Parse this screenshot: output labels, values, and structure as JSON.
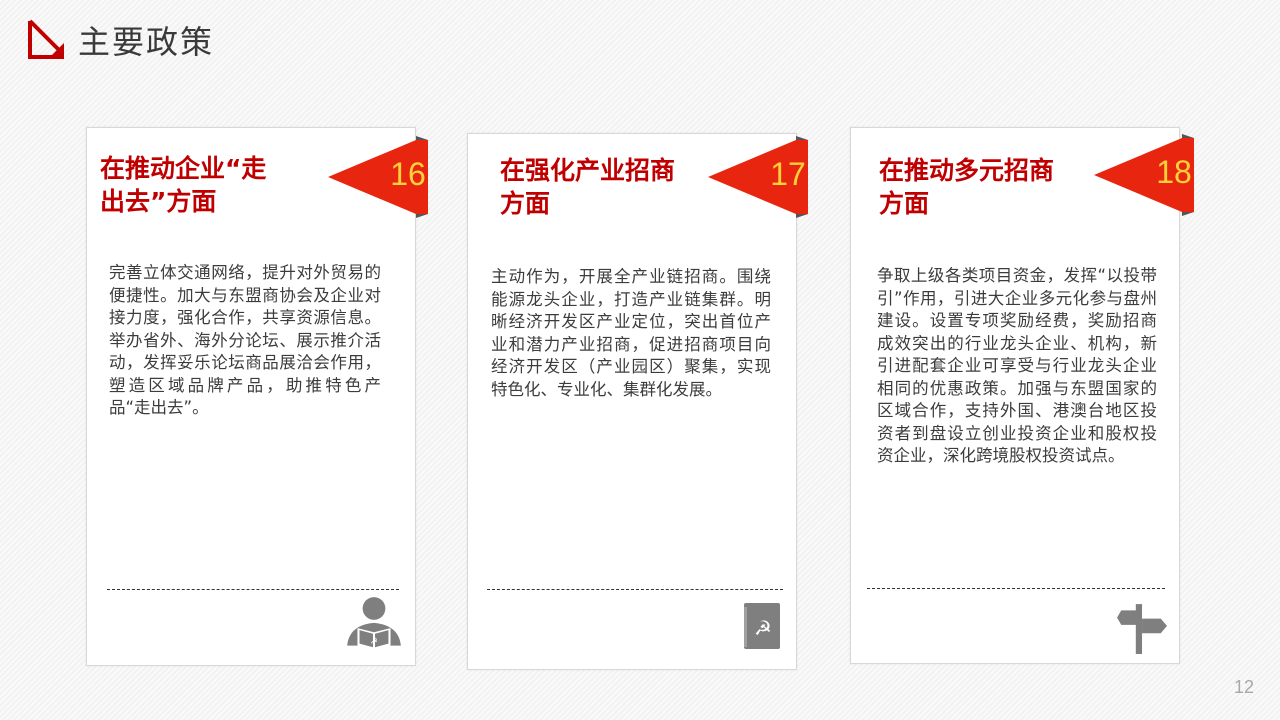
{
  "header": {
    "icon": "arrow-down-right-icon",
    "title": "主要政策"
  },
  "colors": {
    "accent": "#c00000",
    "badge_red": "#e02010",
    "badge_number": "#ffd23a",
    "icon_gray": "#7f7f7f"
  },
  "cards": [
    {
      "number": "16",
      "title_line1": "在推动企业“走",
      "title_line2": "出去”方面",
      "body": "完善立体交通网络，提升对外贸易的便捷性。加大与东盟商协会及企业对接力度，强化合作，共享资源信息。举办省外、海外分论坛、展示推介活动，发挥妥乐论坛商品展洽会作用，塑造区域品牌产品，助推特色产品“走出去”。",
      "icon": "person-reading-icon"
    },
    {
      "number": "17",
      "title_line1": "在强化产业招商",
      "title_line2": "方面",
      "body": "主动作为，开展全产业链招商。围绕能源龙头企业，打造产业链集群。明晰经济开发区产业定位，突出首位产业和潜力产业招商，促进招商项目向经济开发区（产业园区）聚集，实现特色化、专业化、集群化发展。",
      "icon": "party-book-icon"
    },
    {
      "number": "18",
      "title_line1": "在推动多元招商",
      "title_line2": "方面",
      "body": "争取上级各类项目资金，发挥“以投带引”作用，引进大企业多元化参与盘州建设。设置专项奖励经费，奖励招商成效突出的行业龙头企业、机构，新引进配套企业可享受与行业龙头企业相同的优惠政策。加强与东盟国家的区域合作，支持外国、港澳台地区投资者到盘设立创业投资企业和股权投资企业，深化跨境股权投资试点。",
      "icon": "signpost-icon"
    }
  ],
  "page_number": "12"
}
